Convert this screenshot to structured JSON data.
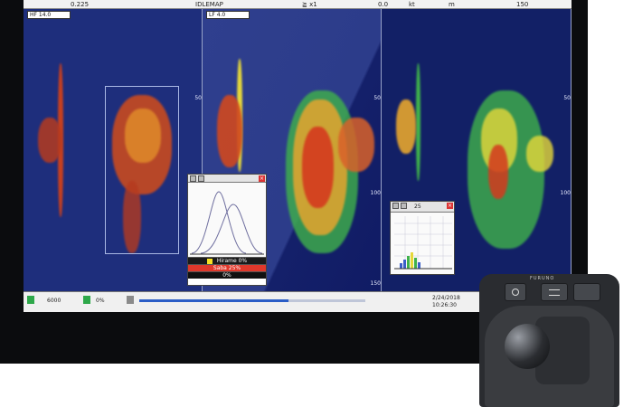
{
  "status_bar": {
    "item1": "0.225",
    "item2": "IDLEMAP",
    "item3": "≧ x1",
    "item4": "0.0",
    "item5": "kt",
    "item6": "m",
    "item7": "150"
  },
  "panes": {
    "left_label": "HF 14.0",
    "mid_label": "LF 4.0",
    "depth_ticks": [
      "50",
      "100",
      "150"
    ]
  },
  "fish_popup": {
    "species": [
      {
        "label": "Hirame 0%",
        "color": "#f7e024"
      },
      {
        "label": "Saba 25%",
        "color": "#e0382b"
      },
      {
        "label": "0%",
        "color": "#111111"
      }
    ]
  },
  "histogram_popup": {
    "value": "25"
  },
  "bottom_bar": {
    "left_value": "6000",
    "mid_value": "0%",
    "right_text": "2/24/2018",
    "right_subtext": "10:26:30",
    "progress": 0.66
  },
  "controller": {
    "brand": "FURUNO"
  },
  "colors": {
    "screen_bg": "#1f2f7e",
    "echo_red": "#c8401e",
    "echo_orange": "#e08a2a",
    "echo_yellow": "#e6d83a",
    "echo_green": "#3fb24b"
  }
}
